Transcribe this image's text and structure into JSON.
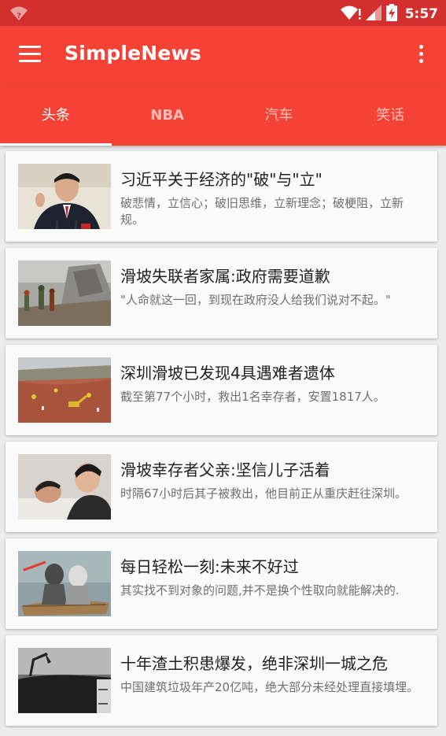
{
  "status_bar": {
    "time": "5:57",
    "icons": [
      "wifi-question-icon",
      "signal-icon",
      "battery-charging-icon"
    ]
  },
  "toolbar": {
    "title": "SimpleNews",
    "icons": [
      "hamburger-menu-icon",
      "overflow-menu-icon"
    ]
  },
  "tabs": [
    {
      "label": "头条"
    },
    {
      "label": "NBA"
    },
    {
      "label": "汽车"
    },
    {
      "label": "笑话"
    }
  ],
  "news": [
    {
      "title": "习近平关于经济的\"破\"与\"立\"",
      "desc": "破悲情，立信心；破旧思维，立新理念；破梗阻，立新规。"
    },
    {
      "title": "滑坡失联者家属:政府需要道歉",
      "desc": "\"人命就这一回，到现在政府没人给我们说对不起。\""
    },
    {
      "title": "深圳滑坡已发现4具遇难者遗体",
      "desc": "截至第77个小时，救出1名幸存者，安置1817人。"
    },
    {
      "title": "滑坡幸存者父亲:坚信儿子活着",
      "desc": "时隔67小时后其子被救出，他目前正从重庆赶往深圳。"
    },
    {
      "title": "每日轻松一刻:未来不好过",
      "desc": "其实找不到对象的问题,并不是换个性取向就能解决的."
    },
    {
      "title": "十年渣土积患爆发，绝非深圳一城之危",
      "desc": "中国建筑垃圾年产20亿吨，绝大部分未经处理直接填埋。"
    }
  ],
  "colors": {
    "primary": "#f44336",
    "status_bar": "#d32f2f",
    "background": "#ececec"
  }
}
